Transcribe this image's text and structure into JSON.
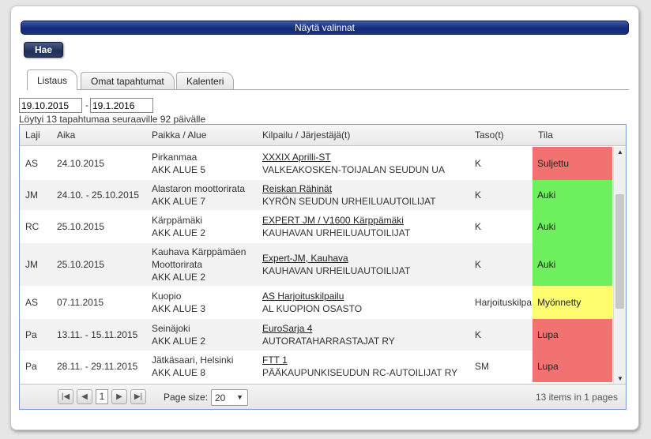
{
  "options_bar": {
    "label": "Näytä valinnat"
  },
  "search_button": {
    "label": "Hae"
  },
  "tabs": [
    {
      "label": "Listaus",
      "active": true
    },
    {
      "label": "Omat tapahtumat",
      "active": false
    },
    {
      "label": "Kalenteri",
      "active": false
    }
  ],
  "dates": {
    "start": "19.10.2015",
    "separator": "-",
    "end": "19.1.2016"
  },
  "result_text": "Löytyi 13 tapahtumaa seuraaville 92 päivälle",
  "columns": {
    "laji": "Laji",
    "aika": "Aika",
    "paikka": "Paikka / Alue",
    "kilpailu": "Kilpailu / Järjestäjä(t)",
    "taso": "Taso(t)",
    "tila": "Tila"
  },
  "status_colors": {
    "Suljettu": "#f27272",
    "Auki": "#6eef5e",
    "Myönnetty": "#fdfd6f",
    "Lupa": "#f27272"
  },
  "rows": [
    {
      "laji": "AS",
      "aika": "24.10.2015",
      "paikka": [
        "Pirkanmaa",
        "AKK ALUE 5"
      ],
      "kilpailu": "XXXIX Aprilli-ST",
      "jarjestaja": "VALKEAKOSKEN-TOIJALAN SEUDUN UA",
      "taso": "K",
      "tila": "Suljettu"
    },
    {
      "laji": "JM",
      "aika": "24.10. - 25.10.2015",
      "paikka": [
        "Alastaron moottorirata",
        "AKK ALUE 7"
      ],
      "kilpailu": "Reiskan Rähinät",
      "jarjestaja": "KYRÖN SEUDUN URHEILUAUTOILIJAT",
      "taso": "K",
      "tila": "Auki"
    },
    {
      "laji": "RC",
      "aika": "25.10.2015",
      "paikka": [
        "Kärppämäki",
        "AKK ALUE 2"
      ],
      "kilpailu": "EXPERT JM / V1600 Kärppämäki",
      "jarjestaja": "KAUHAVAN URHEILUAUTOILIJAT",
      "taso": "K",
      "tila": "Auki"
    },
    {
      "laji": "JM",
      "aika": "25.10.2015",
      "paikka": [
        "Kauhava Kärppämäen",
        "Moottorirata",
        "AKK ALUE 2"
      ],
      "kilpailu": "Expert-JM, Kauhava",
      "jarjestaja": "KAUHAVAN URHEILUAUTOILIJAT",
      "taso": "K",
      "tila": "Auki"
    },
    {
      "laji": "AS",
      "aika": "07.11.2015",
      "paikka": [
        "Kuopio",
        "AKK ALUE 3"
      ],
      "kilpailu": "AS Harjoituskilpailu",
      "jarjestaja": "AL KUOPION OSASTO",
      "taso": "Harjoituskilpa",
      "tila": "Myönnetty"
    },
    {
      "laji": "Pa",
      "aika": "13.11. - 15.11.2015",
      "paikka": [
        "Seinäjoki",
        "AKK ALUE 2"
      ],
      "kilpailu": "EuroSarja 4",
      "jarjestaja": "AUTORATAHARRASTAJAT RY",
      "taso": "K",
      "tila": "Lupa"
    },
    {
      "laji": "Pa",
      "aika": "28.11. - 29.11.2015",
      "paikka": [
        "Jätkäsaari, Helsinki",
        "AKK ALUE 8"
      ],
      "kilpailu": "FTT 1",
      "jarjestaja": "PÄÄKAUPUNKISEUDUN RC-AUTOILIJAT RY",
      "taso": "SM",
      "tila": "Lupa"
    }
  ],
  "pager": {
    "first_icon": "first-page-icon",
    "prev_icon": "prev-page-icon",
    "next_icon": "next-page-icon",
    "last_icon": "last-page-icon",
    "current_page": "1",
    "page_size_label": "Page size:",
    "page_size": "20",
    "info": "13 items in 1 pages"
  }
}
